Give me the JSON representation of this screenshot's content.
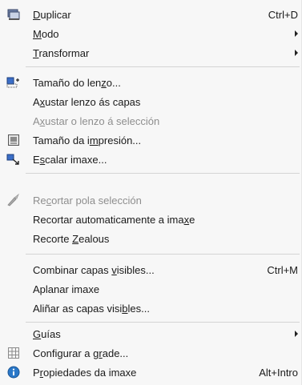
{
  "menu": {
    "items": [
      {
        "id": "duplicar",
        "pre": "",
        "u": "D",
        "post": "uplicar",
        "shortcut": "Ctrl+D",
        "submenu": false,
        "disabled": false,
        "icon": "duplicate-image-icon"
      },
      {
        "id": "modo",
        "pre": "",
        "u": "M",
        "post": "odo",
        "shortcut": "",
        "submenu": true,
        "disabled": false,
        "icon": ""
      },
      {
        "id": "transformar",
        "pre": "",
        "u": "T",
        "post": "ransformar",
        "shortcut": "",
        "submenu": true,
        "disabled": false,
        "icon": ""
      },
      {
        "id": "tamano-lenzo",
        "pre": "Tamaño do len",
        "u": "z",
        "post": "o...",
        "shortcut": "",
        "submenu": false,
        "disabled": false,
        "icon": "canvas-size-icon"
      },
      {
        "id": "axustar-lenzo-capas",
        "pre": "A",
        "u": "x",
        "post": "ustar lenzo ás capas",
        "shortcut": "",
        "submenu": false,
        "disabled": false,
        "icon": ""
      },
      {
        "id": "axustar-lenzo-seleccion",
        "pre": "A",
        "u": "x",
        "post": "ustar o lenzo á selección",
        "shortcut": "",
        "submenu": false,
        "disabled": true,
        "icon": ""
      },
      {
        "id": "tamano-impresion",
        "pre": "Tamaño da i",
        "u": "m",
        "post": "presión...",
        "shortcut": "",
        "submenu": false,
        "disabled": false,
        "icon": "print-size-icon"
      },
      {
        "id": "escalar-imaxe",
        "pre": "E",
        "u": "s",
        "post": "calar imaxe...",
        "shortcut": "",
        "submenu": false,
        "disabled": false,
        "icon": "scale-image-icon"
      },
      {
        "id": "recortar-seleccion",
        "pre": "Re",
        "u": "c",
        "post": "ortar pola selección",
        "shortcut": "",
        "submenu": false,
        "disabled": true,
        "icon": "crop-knife-icon"
      },
      {
        "id": "recortar-automaticamente",
        "pre": "Recortar automaticamente a ima",
        "u": "x",
        "post": "e",
        "shortcut": "",
        "submenu": false,
        "disabled": false,
        "icon": ""
      },
      {
        "id": "recorte-zealous",
        "pre": "Recorte ",
        "u": "Z",
        "post": "ealous",
        "shortcut": "",
        "submenu": false,
        "disabled": false,
        "icon": ""
      },
      {
        "id": "combinar-capas",
        "pre": "Combinar capas ",
        "u": "v",
        "post": "isibles...",
        "shortcut": "Ctrl+M",
        "submenu": false,
        "disabled": false,
        "icon": ""
      },
      {
        "id": "aplanar-imaxe",
        "pre": "Aplanar imaxe",
        "u": "",
        "post": "",
        "shortcut": "",
        "submenu": false,
        "disabled": false,
        "icon": ""
      },
      {
        "id": "alinar-capas",
        "pre": "Aliñar as capas visi",
        "u": "b",
        "post": "les...",
        "shortcut": "",
        "submenu": false,
        "disabled": false,
        "icon": ""
      },
      {
        "id": "guias",
        "pre": "",
        "u": "G",
        "post": "uías",
        "shortcut": "",
        "submenu": true,
        "disabled": false,
        "icon": ""
      },
      {
        "id": "configurar-grade",
        "pre": "Configurar a g",
        "u": "r",
        "post": "ade...",
        "shortcut": "",
        "submenu": false,
        "disabled": false,
        "icon": "grid-icon"
      },
      {
        "id": "propiedades-imaxe",
        "pre": "P",
        "u": "r",
        "post": "opiedades da imaxe",
        "shortcut": "Alt+Intro",
        "submenu": false,
        "disabled": false,
        "icon": "info-icon"
      }
    ]
  },
  "colors": {
    "menu_background": "#f7f7f7",
    "text": "#1a1a1a",
    "disabled_text": "#8e8e8e",
    "separator": "#d4d4d4",
    "info_icon": "#2a78c8"
  }
}
